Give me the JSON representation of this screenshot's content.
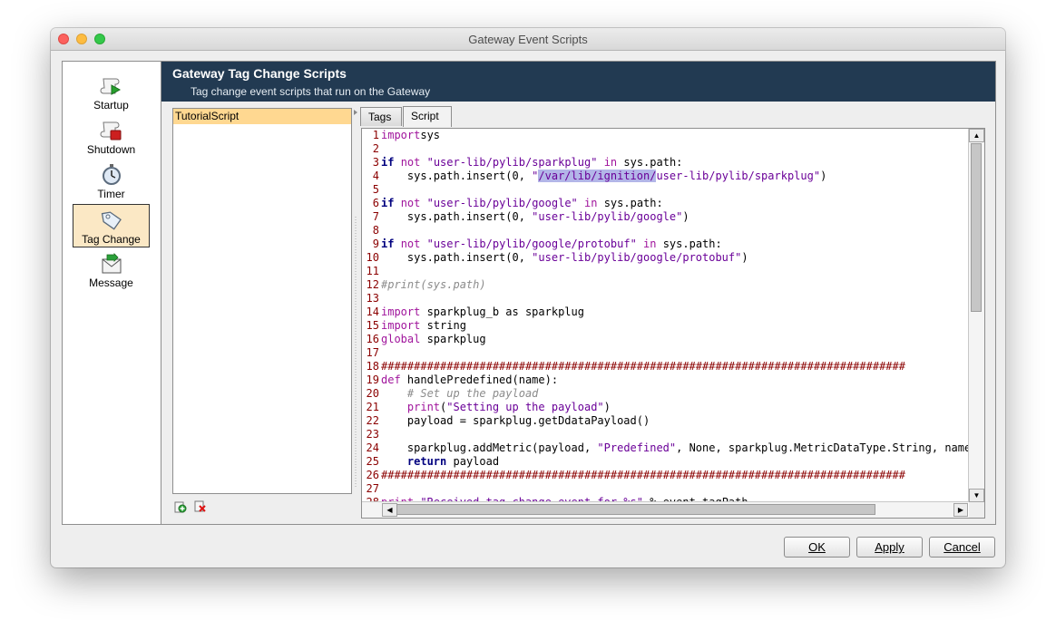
{
  "window": {
    "title": "Gateway Event Scripts"
  },
  "nav": {
    "items": [
      {
        "label": "Startup",
        "icon": "startup-scroll-icon"
      },
      {
        "label": "Shutdown",
        "icon": "shutdown-scroll-icon"
      },
      {
        "label": "Timer",
        "icon": "timer-icon"
      },
      {
        "label": "Tag Change",
        "icon": "tag-icon",
        "selected": true
      },
      {
        "label": "Message",
        "icon": "message-envelope-icon"
      }
    ]
  },
  "banner": {
    "title": "Gateway Tag Change Scripts",
    "subtitle": "Tag change event scripts that run on the Gateway"
  },
  "scripts": {
    "items": [
      "TutorialScript"
    ],
    "add_icon": "add-script-icon",
    "remove_icon": "remove-script-icon"
  },
  "tabs": [
    "Tags",
    "Script"
  ],
  "active_tab": "Script",
  "editor": {
    "lines": [
      {
        "n": "1",
        "tokens": [
          [
            "kw",
            "import"
          ],
          [
            "",
            "sys"
          ]
        ]
      },
      {
        "n": "2",
        "tokens": []
      },
      {
        "n": "3",
        "tokens": [
          [
            "kwb",
            "if"
          ],
          [
            "",
            " "
          ],
          [
            "kw",
            "not"
          ],
          [
            "",
            " "
          ],
          [
            "st",
            "\"user-lib/pylib/sparkplug\""
          ],
          [
            "",
            " "
          ],
          [
            "kw",
            "in"
          ],
          [
            "",
            " sys.path:"
          ]
        ]
      },
      {
        "n": "4",
        "tokens": [
          [
            "",
            "    sys.path.insert(0, "
          ],
          [
            "st",
            "\""
          ],
          [
            "st sel",
            "/var/lib/ignition/"
          ],
          [
            "st",
            "user-lib/pylib/sparkplug\""
          ],
          [
            "",
            ")"
          ]
        ]
      },
      {
        "n": "5",
        "tokens": []
      },
      {
        "n": "6",
        "tokens": [
          [
            "kwb",
            "if"
          ],
          [
            "",
            " "
          ],
          [
            "kw",
            "not"
          ],
          [
            "",
            " "
          ],
          [
            "st",
            "\"user-lib/pylib/google\""
          ],
          [
            "",
            " "
          ],
          [
            "kw",
            "in"
          ],
          [
            "",
            " sys.path:"
          ]
        ]
      },
      {
        "n": "7",
        "tokens": [
          [
            "",
            "    sys.path.insert(0, "
          ],
          [
            "st",
            "\"user-lib/pylib/google\""
          ],
          [
            "",
            ")"
          ]
        ]
      },
      {
        "n": "8",
        "tokens": []
      },
      {
        "n": "9",
        "tokens": [
          [
            "kwb",
            "if"
          ],
          [
            "",
            " "
          ],
          [
            "kw",
            "not"
          ],
          [
            "",
            " "
          ],
          [
            "st",
            "\"user-lib/pylib/google/protobuf\""
          ],
          [
            "",
            " "
          ],
          [
            "kw",
            "in"
          ],
          [
            "",
            " sys.path:"
          ]
        ]
      },
      {
        "n": "10",
        "tokens": [
          [
            "",
            "    sys.path.insert(0, "
          ],
          [
            "st",
            "\"user-lib/pylib/google/protobuf\""
          ],
          [
            "",
            ")"
          ]
        ]
      },
      {
        "n": "11",
        "tokens": []
      },
      {
        "n": "12",
        "tokens": [
          [
            "cm",
            "#print(sys.path)"
          ]
        ]
      },
      {
        "n": "13",
        "tokens": []
      },
      {
        "n": "14",
        "tokens": [
          [
            "kw",
            "import"
          ],
          [
            "",
            " sparkplug_b as sparkplug"
          ]
        ]
      },
      {
        "n": "15",
        "tokens": [
          [
            "kw",
            "import"
          ],
          [
            "",
            " string"
          ]
        ]
      },
      {
        "n": "16",
        "tokens": [
          [
            "kw",
            "global"
          ],
          [
            "",
            " sparkplug"
          ]
        ]
      },
      {
        "n": "17",
        "tokens": []
      },
      {
        "n": "18",
        "tokens": [
          [
            "hdr",
            "################################################################################"
          ]
        ]
      },
      {
        "n": "19",
        "tokens": [
          [
            "kw",
            "def"
          ],
          [
            "",
            " handlePredefined(name):"
          ]
        ]
      },
      {
        "n": "20",
        "tokens": [
          [
            "",
            "    "
          ],
          [
            "cm",
            "# Set up the payload"
          ]
        ]
      },
      {
        "n": "21",
        "tokens": [
          [
            "",
            "    "
          ],
          [
            "kw",
            "print"
          ],
          [
            "",
            "("
          ],
          [
            "st",
            "\"Setting up the payload\""
          ],
          [
            "",
            ")"
          ]
        ]
      },
      {
        "n": "22",
        "tokens": [
          [
            "",
            "    payload = sparkplug.getDdataPayload()"
          ]
        ]
      },
      {
        "n": "23",
        "tokens": []
      },
      {
        "n": "24",
        "tokens": [
          [
            "",
            "    sparkplug.addMetric(payload, "
          ],
          [
            "st",
            "\"Predefined\""
          ],
          [
            "",
            ", None, sparkplug.MetricDataType.String, name)"
          ]
        ]
      },
      {
        "n": "25",
        "tokens": [
          [
            "",
            "    "
          ],
          [
            "kwb",
            "return"
          ],
          [
            "",
            " payload"
          ]
        ]
      },
      {
        "n": "26",
        "tokens": [
          [
            "hdr",
            "################################################################################"
          ]
        ]
      },
      {
        "n": "27",
        "tokens": []
      },
      {
        "n": "28",
        "tokens": [
          [
            "kw",
            "print"
          ],
          [
            "",
            " "
          ],
          [
            "st",
            "\"Received tag change event for %s\""
          ],
          [
            "",
            " % event.tagPath"
          ]
        ]
      }
    ]
  },
  "buttons": {
    "ok": "OK",
    "apply": "Apply",
    "cancel": "Cancel"
  }
}
